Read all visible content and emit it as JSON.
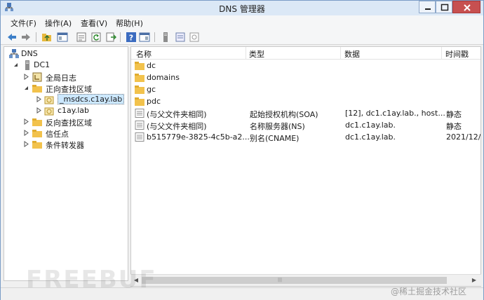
{
  "window": {
    "title": "DNS 管理器"
  },
  "menu": {
    "items": [
      {
        "label": "文件(F)"
      },
      {
        "label": "操作(A)"
      },
      {
        "label": "查看(V)"
      },
      {
        "label": "帮助(H)"
      }
    ]
  },
  "toolbar": {
    "buttons": [
      "back-arrow-icon",
      "forward-arrow-icon",
      "folder-up-icon",
      "show-hide-console-tree-icon",
      "properties-icon",
      "refresh-icon",
      "export-list-icon",
      "help-icon",
      "show-hide-action-pane-icon",
      "server-icon",
      "zone-icon",
      "record-icon"
    ]
  },
  "tree": {
    "nodes": [
      {
        "label": "DNS",
        "icon": "dns-icon",
        "expanded": true
      },
      {
        "label": "DC1",
        "icon": "server-icon",
        "expanded": true
      },
      {
        "label": "全局日志",
        "icon": "log-icon",
        "expanded": false
      },
      {
        "label": "正向查找区域",
        "icon": "folder-icon",
        "expanded": true
      },
      {
        "label": "_msdcs.c1ay.lab",
        "icon": "zone-icon",
        "expanded": false,
        "selected": true
      },
      {
        "label": "c1ay.lab",
        "icon": "zone-icon",
        "expanded": false
      },
      {
        "label": "反向查找区域",
        "icon": "folder-icon",
        "expanded": false
      },
      {
        "label": "信任点",
        "icon": "folder-icon",
        "expanded": false
      },
      {
        "label": "条件转发器",
        "icon": "folder-icon",
        "expanded": false
      }
    ]
  },
  "list": {
    "columns": [
      "名称",
      "类型",
      "数据",
      "时间戳"
    ],
    "rows": [
      {
        "icon": "folder-icon",
        "name": "dc",
        "type": "",
        "data": "",
        "timestamp": ""
      },
      {
        "icon": "folder-icon",
        "name": "domains",
        "type": "",
        "data": "",
        "timestamp": ""
      },
      {
        "icon": "folder-icon",
        "name": "gc",
        "type": "",
        "data": "",
        "timestamp": ""
      },
      {
        "icon": "folder-icon",
        "name": "pdc",
        "type": "",
        "data": "",
        "timestamp": ""
      },
      {
        "icon": "record-icon",
        "name": "(与父文件夹相同)",
        "type": "起始授权机构(SOA)",
        "data": "[12], dc1.c1ay.lab., host...",
        "timestamp": "静态"
      },
      {
        "icon": "record-icon",
        "name": "(与父文件夹相同)",
        "type": "名称服务器(NS)",
        "data": "dc1.c1ay.lab.",
        "timestamp": "静态"
      },
      {
        "icon": "record-icon",
        "name": "b515779e-3825-4c5b-a2...",
        "type": "别名(CNAME)",
        "data": "dc1.c1ay.lab.",
        "timestamp": "2021/12/"
      }
    ]
  },
  "watermark": {
    "main": "FREEBUF",
    "corner": "@稀土掘金技术社区"
  },
  "colors": {
    "title_bg": "#dbe8f6",
    "close_button": "#c75050",
    "folder": "#f2c24c",
    "selection": "#cce8ff"
  }
}
